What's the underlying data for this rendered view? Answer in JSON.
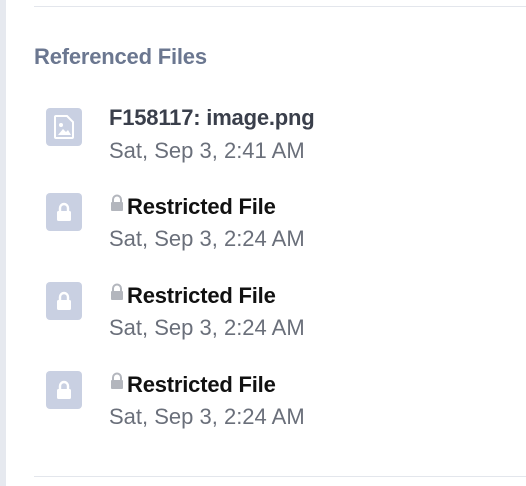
{
  "referenced_files": {
    "title": "Referenced Files",
    "items": [
      {
        "name": "F158117: image.png",
        "date": "Sat, Sep 3, 2:41 AM",
        "icon": "image-file-icon",
        "restricted": false
      },
      {
        "name": "Restricted File",
        "date": "Sat, Sep 3, 2:24 AM",
        "icon": "lock-file-icon",
        "restricted": true
      },
      {
        "name": "Restricted File",
        "date": "Sat, Sep 3, 2:24 AM",
        "icon": "lock-file-icon",
        "restricted": true
      },
      {
        "name": "Restricted File",
        "date": "Sat, Sep 3, 2:24 AM",
        "icon": "lock-file-icon",
        "restricted": true
      }
    ]
  },
  "colors": {
    "icon_tile": "#c9d0e2",
    "title": "#6b7790",
    "inline_lock": "#b3b6bd"
  }
}
